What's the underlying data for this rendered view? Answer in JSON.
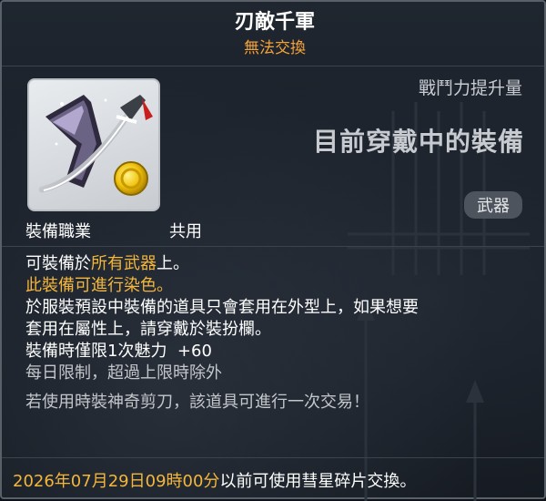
{
  "item": {
    "name": "刃敵千軍",
    "trade_status": "無法交換"
  },
  "compare": {
    "power_label": "戰鬥力提升量",
    "equipped_text": "目前穿戴中的裝備",
    "category_tag": "武器"
  },
  "job": {
    "label": "裝備職業",
    "value": "共用"
  },
  "description": {
    "line1_prefix": "可裝備於",
    "line1_highlight": "所有武器",
    "line1_suffix": "上。",
    "line2": "此裝備可進行染色。",
    "line3": "於服裝預設中裝備的道具只會套用在外型上，如果想要",
    "line4": "套用在屬性上，請穿戴於裝扮欄。",
    "line5_label": "裝備時僅限1次魅力",
    "line5_value": "+60",
    "line6": "每日限制，超過上限時除外",
    "line7": "若使用時裝神奇剪刀，該道具可進行一次交易！"
  },
  "footer": {
    "date": "2026年07月29日09時00分",
    "suffix": "以前可使用彗星碎片交換。"
  },
  "icon": {
    "name": "sword-with-coin-icon"
  },
  "colors": {
    "orange": "#f4a238",
    "highlight": "#f4b63b",
    "background": "#1a2029"
  }
}
